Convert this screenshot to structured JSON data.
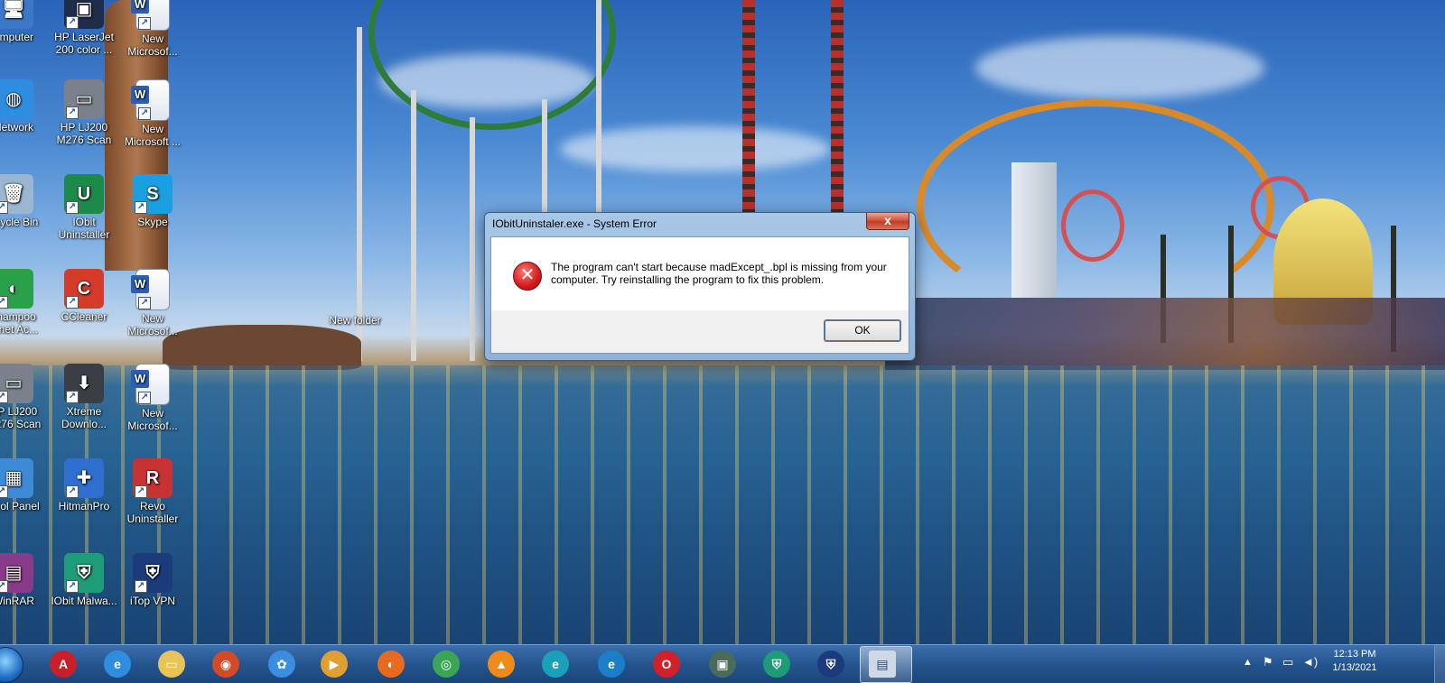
{
  "desktop": {
    "icons": [
      {
        "label": "omputer",
        "glyph": "🖥",
        "bg": "#3b78c8"
      },
      {
        "label": "HP LaserJet 200 color ...",
        "glyph": "▣",
        "bg": "#1f2c4a"
      },
      {
        "label": "New Microsof...",
        "glyph": "W",
        "bg": "doc"
      },
      {
        "label": "Network",
        "glyph": "◍",
        "bg": "#2f8de0"
      },
      {
        "label": "HP LJ200 M276 Scan",
        "glyph": "▭",
        "bg": "#7a808c"
      },
      {
        "label": "New Microsoft ...",
        "glyph": "W",
        "bg": "doc"
      },
      {
        "label": "ecycle Bin",
        "glyph": "🗑",
        "bg": "#9ab6d0"
      },
      {
        "label": "IObit Uninstaller",
        "glyph": "U",
        "bg": "#1c8a4a"
      },
      {
        "label": "Skype",
        "glyph": "S",
        "bg": "#1a9fe0"
      },
      {
        "label": "shampoo ernet Ac...",
        "glyph": "◐",
        "bg": "#2aa04a"
      },
      {
        "label": "CCleaner",
        "glyph": "C",
        "bg": "#d43b2b"
      },
      {
        "label": "New Microsof...",
        "glyph": "W",
        "bg": "doc"
      },
      {
        "label": "New folder",
        "glyph": "",
        "bg": "none"
      },
      {
        "label": "HP LJ200 M276 Scan",
        "glyph": "▭",
        "bg": "#7a808c"
      },
      {
        "label": "Xtreme Downlo...",
        "glyph": "⬇",
        "bg": "#3a3f46"
      },
      {
        "label": "New Microsof...",
        "glyph": "W",
        "bg": "doc"
      },
      {
        "label": "ntrol Panel",
        "glyph": "▦",
        "bg": "#3e8ad6"
      },
      {
        "label": "HitmanPro",
        "glyph": "✚",
        "bg": "#2f6fd0"
      },
      {
        "label": "Revo Uninstaller",
        "glyph": "R",
        "bg": "#c73232"
      },
      {
        "label": "WinRAR",
        "glyph": "▤",
        "bg": "#8a3a8a"
      },
      {
        "label": "IObit Malwa...",
        "glyph": "⛨",
        "bg": "#1e9b77"
      },
      {
        "label": "iTop VPN",
        "glyph": "⛨",
        "bg": "#1c3b7c"
      }
    ]
  },
  "dialog": {
    "title": "IObitUninstaler.exe - System Error",
    "close_label": "x",
    "message_line1": "The program can't start because madExcept_.bpl is missing from your",
    "message_line2": "computer. Try reinstalling the program to fix this problem.",
    "error_glyph": "✕",
    "ok_label": "OK"
  },
  "taskbar": {
    "apps": [
      {
        "name": "adobe-reader",
        "glyph": "A",
        "bg": "#c8202a"
      },
      {
        "name": "internet-explorer",
        "glyph": "e",
        "bg": "#2f8de0"
      },
      {
        "name": "file-explorer",
        "glyph": "▭",
        "bg": "#e8c35a"
      },
      {
        "name": "unknown-red",
        "glyph": "◉",
        "bg": "#d24a2a"
      },
      {
        "name": "cloud-app",
        "glyph": "✿",
        "bg": "#3a8de0"
      },
      {
        "name": "media-player",
        "glyph": "▶",
        "bg": "#e0a030"
      },
      {
        "name": "firefox",
        "glyph": "◐",
        "bg": "#e76a1e"
      },
      {
        "name": "chrome",
        "glyph": "◎",
        "bg": "#3aa655"
      },
      {
        "name": "vlc",
        "glyph": "▲",
        "bg": "#f08a1a"
      },
      {
        "name": "edge",
        "glyph": "e",
        "bg": "#1aa0b8"
      },
      {
        "name": "edge-2",
        "glyph": "e",
        "bg": "#1a7fc8"
      },
      {
        "name": "opera",
        "glyph": "O",
        "bg": "#d0202a"
      },
      {
        "name": "monitor-app",
        "glyph": "▣",
        "bg": "#4a6a5a"
      },
      {
        "name": "iobit-malware",
        "glyph": "⛨",
        "bg": "#1e9b77"
      },
      {
        "name": "itop-vpn",
        "glyph": "⛨",
        "bg": "#1c3b7c"
      },
      {
        "name": "active-window",
        "glyph": "▤",
        "bg": "#cfd8e4"
      }
    ],
    "clock_time": "12:13 PM",
    "clock_date": "1/13/2021"
  }
}
